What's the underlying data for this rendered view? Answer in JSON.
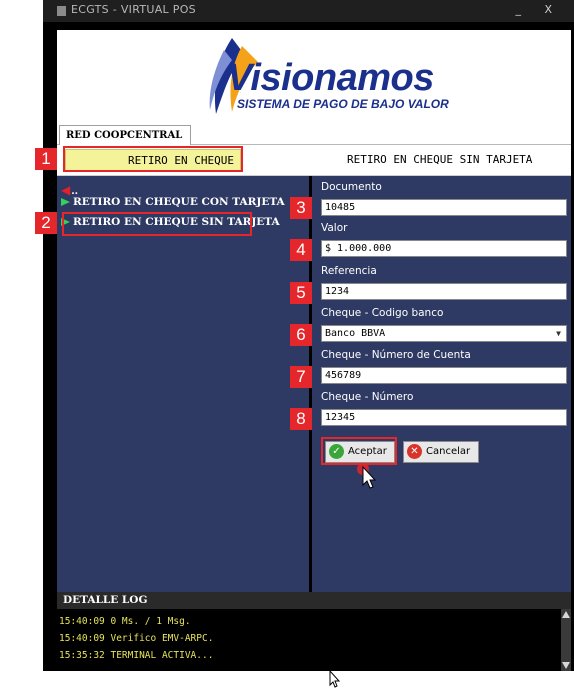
{
  "window": {
    "title": "ECGTS - VIRTUAL POS",
    "controls": "_ X"
  },
  "logo": {
    "title": "Visionamos",
    "subtitle": "SISTEMA DE PAGO DE BAJO VALOR"
  },
  "tabs": [
    {
      "label": "RED COOPCENTRAL"
    }
  ],
  "header": {
    "left_title": "RETIRO EN CHEQUE",
    "right_title": "RETIRO EN CHEQUE SIN TARJETA"
  },
  "menu": {
    "back_label": "..",
    "items": [
      {
        "label": "RETIRO EN CHEQUE CON TARJETA"
      },
      {
        "label": "RETIRO EN CHEQUE SIN TARJETA"
      }
    ]
  },
  "form": {
    "documento": {
      "label": "Documento",
      "value": "10485"
    },
    "valor": {
      "label": "Valor",
      "value": "$ 1.000.000"
    },
    "referencia": {
      "label": "Referencia",
      "value": "1234"
    },
    "codigo_banco": {
      "label": "Cheque - Codigo banco",
      "value": "Banco BBVA"
    },
    "numero_cuenta": {
      "label": "Cheque - Número de Cuenta",
      "value": "456789"
    },
    "numero": {
      "label": "Cheque - Número",
      "value": "12345"
    }
  },
  "buttons": {
    "accept": "Aceptar",
    "cancel": "Cancelar"
  },
  "badges": [
    "1",
    "2",
    "3",
    "4",
    "5",
    "6",
    "7",
    "8"
  ],
  "log": {
    "title": "DETALLE LOG",
    "lines": [
      "15:40:09 0 Ms. / 1 Msg.",
      "15:40:09 Verifico EMV-ARPC.",
      "15:35:32 TERMINAL ACTIVA..."
    ]
  },
  "colors": {
    "panel": "#2e3a63",
    "accent_red": "#e5262b",
    "header_yellow": "#f4f39a",
    "log_text": "#e6e35a"
  }
}
